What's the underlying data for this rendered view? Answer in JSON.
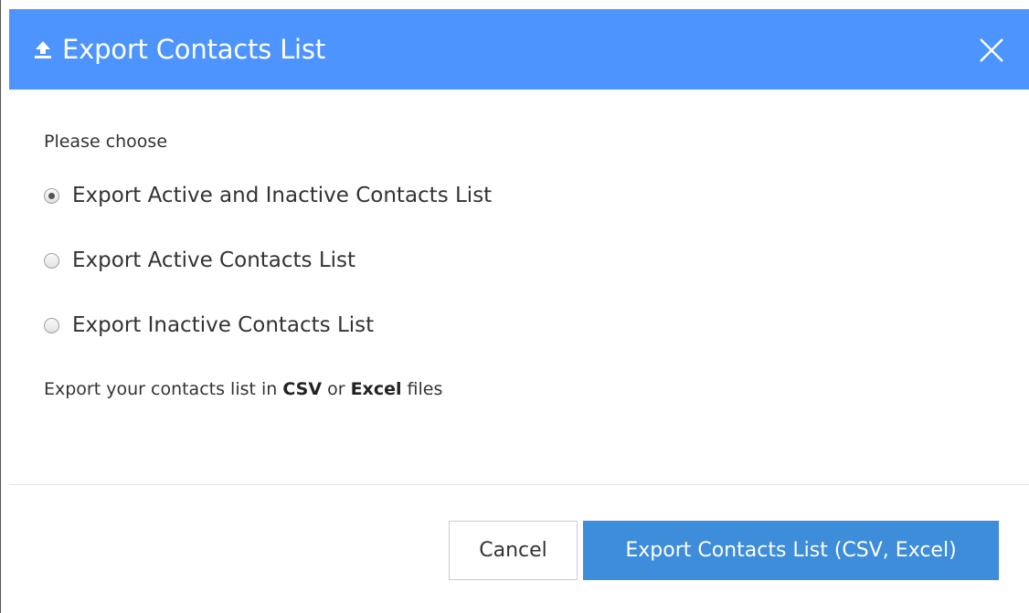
{
  "dialog": {
    "title": "Export Contacts List",
    "title_icon": "upload-icon",
    "close_icon": "close-icon",
    "header_color": "#4d94ff"
  },
  "body": {
    "prompt": "Please choose",
    "options": [
      {
        "label": "Export Active and Inactive Contacts List",
        "checked": true
      },
      {
        "label": "Export Active Contacts List",
        "checked": false
      },
      {
        "label": "Export Inactive Contacts List",
        "checked": false
      }
    ],
    "note": {
      "prefix": "Export your contacts list in",
      "format1": "CSV",
      "joiner": "or",
      "format2": "Excel",
      "suffix": "files"
    }
  },
  "footer": {
    "cancel_label": "Cancel",
    "export_label": "Export Contacts List (CSV, Excel)",
    "export_color": "#3e8ddb"
  }
}
